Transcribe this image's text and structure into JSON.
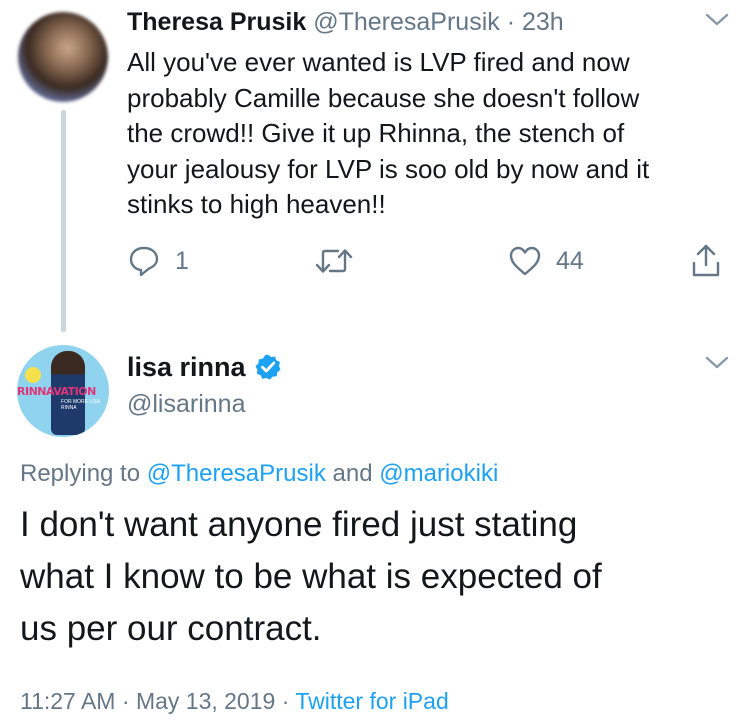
{
  "tweet1": {
    "name": "Theresa Prusik",
    "handle": "@TheresaPrusik",
    "separator": " · ",
    "time": "23h",
    "text": "All you've ever wanted is LVP fired and now\nprobably Camille because she doesn't follow\nthe crowd!! Give it up Rhinna, the stench of\nyour jealousy for LVP  is soo old by now and it\nstinks to high heaven!!",
    "reply_count": "1",
    "retweet_count": "",
    "like_count": "44"
  },
  "tweet2": {
    "name": "lisa rinna",
    "handle": "@lisarinna",
    "avatar_brand": "RINNAVATION",
    "avatar_tagline": "FOR MORE LISA RINNA",
    "replying_prefix": "Replying to ",
    "mention1": "@TheresaPrusik",
    "replying_and": " and ",
    "mention2": "@mariokiki",
    "text": "I don't want anyone fired just stating\nwhat I know to be what is expected of\nus per our contract.",
    "time": "11:27 AM",
    "date": "May 13, 2019",
    "separator": " · ",
    "source": "Twitter for iPad"
  },
  "icons": {
    "reply": "reply-icon",
    "retweet": "retweet-icon",
    "like": "heart-icon",
    "share": "share-icon",
    "more": "chevron-down-icon",
    "verified": "verified-badge-icon"
  },
  "colors": {
    "text_primary": "#14171a",
    "text_secondary": "#657786",
    "link": "#1da1f2",
    "thread_line": "#ccd6dd"
  }
}
